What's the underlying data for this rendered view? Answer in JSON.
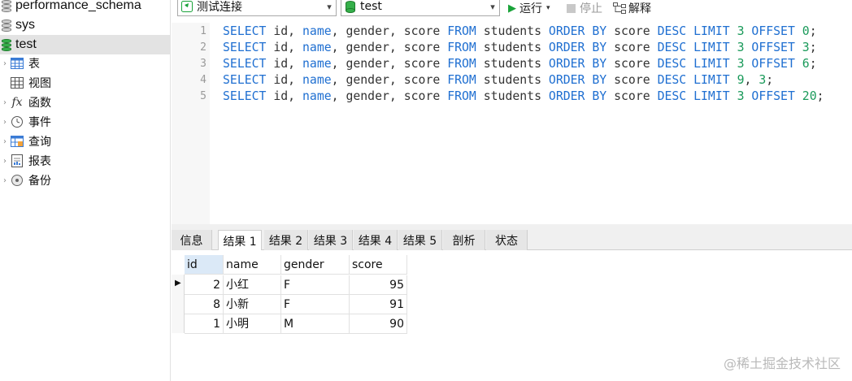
{
  "sidebar": {
    "databases": [
      "performance_schema",
      "sys",
      "test"
    ],
    "selected_database": "test",
    "nodes": [
      {
        "icon": "table-icon",
        "label": "表"
      },
      {
        "icon": "view-icon",
        "label": "视图"
      },
      {
        "icon": "function-icon",
        "label": "函数"
      },
      {
        "icon": "event-icon",
        "label": "事件"
      },
      {
        "icon": "query-icon",
        "label": "查询"
      },
      {
        "icon": "report-icon",
        "label": "报表"
      },
      {
        "icon": "backup-icon",
        "label": "备份"
      }
    ]
  },
  "toolbar": {
    "connection": "测试连接",
    "database": "test",
    "run_label": "运行",
    "stop_label": "停止",
    "explain_label": "解释"
  },
  "editor": {
    "lines": [
      {
        "n": "1",
        "tokens": [
          [
            "kw",
            "SELECT"
          ],
          [
            "txt",
            " id, "
          ],
          [
            "kw",
            "name"
          ],
          [
            "txt",
            ", gender, score "
          ],
          [
            "kw",
            "FROM"
          ],
          [
            "txt",
            " students "
          ],
          [
            "kw",
            "ORDER BY"
          ],
          [
            "txt",
            " score "
          ],
          [
            "kw",
            "DESC LIMIT"
          ],
          [
            "txt",
            " "
          ],
          [
            "num",
            "3"
          ],
          [
            "txt",
            " "
          ],
          [
            "kw",
            "OFFSET"
          ],
          [
            "txt",
            " "
          ],
          [
            "num",
            "0"
          ],
          [
            "txt",
            ";"
          ]
        ]
      },
      {
        "n": "2",
        "tokens": [
          [
            "kw",
            "SELECT"
          ],
          [
            "txt",
            " id, "
          ],
          [
            "kw",
            "name"
          ],
          [
            "txt",
            ", gender, score "
          ],
          [
            "kw",
            "FROM"
          ],
          [
            "txt",
            " students "
          ],
          [
            "kw",
            "ORDER BY"
          ],
          [
            "txt",
            " score "
          ],
          [
            "kw",
            "DESC LIMIT"
          ],
          [
            "txt",
            " "
          ],
          [
            "num",
            "3"
          ],
          [
            "txt",
            " "
          ],
          [
            "kw",
            "OFFSET"
          ],
          [
            "txt",
            " "
          ],
          [
            "num",
            "3"
          ],
          [
            "txt",
            ";"
          ]
        ]
      },
      {
        "n": "3",
        "tokens": [
          [
            "kw",
            "SELECT"
          ],
          [
            "txt",
            " id, "
          ],
          [
            "kw",
            "name"
          ],
          [
            "txt",
            ", gender, score "
          ],
          [
            "kw",
            "FROM"
          ],
          [
            "txt",
            " students "
          ],
          [
            "kw",
            "ORDER BY"
          ],
          [
            "txt",
            " score "
          ],
          [
            "kw",
            "DESC LIMIT"
          ],
          [
            "txt",
            " "
          ],
          [
            "num",
            "3"
          ],
          [
            "txt",
            " "
          ],
          [
            "kw",
            "OFFSET"
          ],
          [
            "txt",
            " "
          ],
          [
            "num",
            "6"
          ],
          [
            "txt",
            ";"
          ]
        ]
      },
      {
        "n": "4",
        "tokens": [
          [
            "kw",
            "SELECT"
          ],
          [
            "txt",
            " id, "
          ],
          [
            "kw",
            "name"
          ],
          [
            "txt",
            ", gender, score "
          ],
          [
            "kw",
            "FROM"
          ],
          [
            "txt",
            " students "
          ],
          [
            "kw",
            "ORDER BY"
          ],
          [
            "txt",
            " score "
          ],
          [
            "kw",
            "DESC LIMIT"
          ],
          [
            "txt",
            " "
          ],
          [
            "num",
            "9"
          ],
          [
            "txt",
            ", "
          ],
          [
            "num",
            "3"
          ],
          [
            "txt",
            ";"
          ]
        ]
      },
      {
        "n": "5",
        "tokens": [
          [
            "kw",
            "SELECT"
          ],
          [
            "txt",
            " id, "
          ],
          [
            "kw",
            "name"
          ],
          [
            "txt",
            ", gender, score "
          ],
          [
            "kw",
            "FROM"
          ],
          [
            "txt",
            " students "
          ],
          [
            "kw",
            "ORDER BY"
          ],
          [
            "txt",
            " score "
          ],
          [
            "kw",
            "DESC LIMIT"
          ],
          [
            "txt",
            " "
          ],
          [
            "num",
            "3"
          ],
          [
            "txt",
            " "
          ],
          [
            "kw",
            "OFFSET"
          ],
          [
            "txt",
            " "
          ],
          [
            "num",
            "20"
          ],
          [
            "txt",
            ";"
          ]
        ]
      }
    ]
  },
  "results": {
    "tabs": [
      "信息",
      "结果 1",
      "结果 2",
      "结果 3",
      "结果 4",
      "结果 5",
      "剖析",
      "状态"
    ],
    "active_tab": "结果 1",
    "columns": [
      "id",
      "name",
      "gender",
      "score"
    ],
    "rows": [
      [
        "2",
        "小红",
        "F",
        "95"
      ],
      [
        "8",
        "小新",
        "F",
        "91"
      ],
      [
        "1",
        "小明",
        "M",
        "90"
      ]
    ]
  },
  "watermark": "@稀土掘金技术社区",
  "colors": {
    "keyword": "#1f6fd1",
    "number": "#1a9a5a",
    "db_active": "#35b04a",
    "run_green": "#1aa33a"
  }
}
